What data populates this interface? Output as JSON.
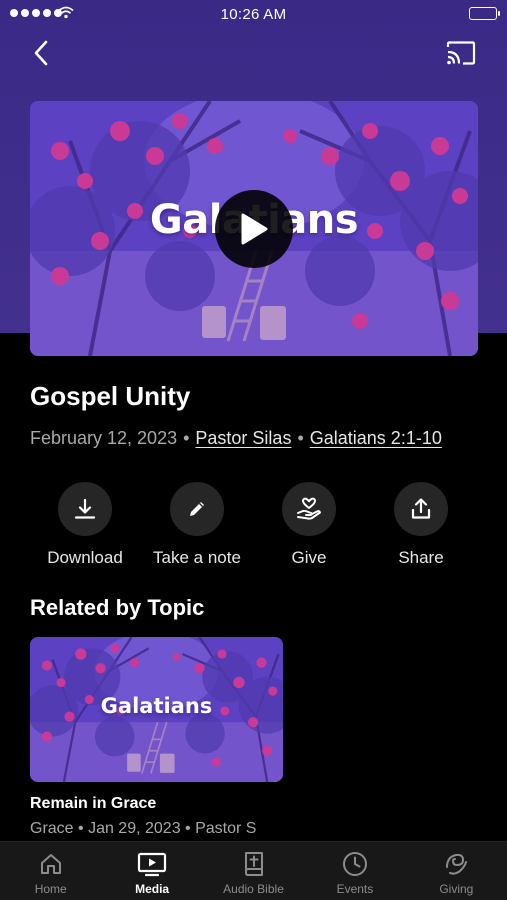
{
  "status_bar": {
    "time": "10:26 AM"
  },
  "nav": {
    "back_icon": "chevron-left-icon",
    "cast_icon": "cast-icon"
  },
  "hero": {
    "art_text": "Galatians",
    "play_icon": "play-icon"
  },
  "sermon": {
    "title": "Gospel Unity",
    "date": "February 12, 2023",
    "separator": "•",
    "speaker": "Pastor Silas",
    "scripture": "Galatians 2:1-10"
  },
  "actions": [
    {
      "label": "Download",
      "icon": "download-icon"
    },
    {
      "label": "Take a note",
      "icon": "pencil-icon"
    },
    {
      "label": "Give",
      "icon": "heart-hand-icon"
    },
    {
      "label": "Share",
      "icon": "share-icon"
    }
  ],
  "related": {
    "heading": "Related by Topic",
    "items": [
      {
        "art_text": "Galatians",
        "title": "Remain in Grace",
        "meta": "Grace • Jan 29, 2023 • Pastor S"
      }
    ]
  },
  "tabs": [
    {
      "label": "Home",
      "icon": "home-icon",
      "active": false
    },
    {
      "label": "Media",
      "icon": "tv-icon",
      "active": true
    },
    {
      "label": "Audio Bible",
      "icon": "bible-icon",
      "active": false
    },
    {
      "label": "Events",
      "icon": "clock-icon",
      "active": false
    },
    {
      "label": "Giving",
      "icon": "giving-icon",
      "active": false
    }
  ],
  "colors": {
    "header_purple": "#3a2a86",
    "artwork_purple": "#7b56d6",
    "background": "#000000",
    "tab_bar": "#181818",
    "action_circle": "#262626"
  }
}
